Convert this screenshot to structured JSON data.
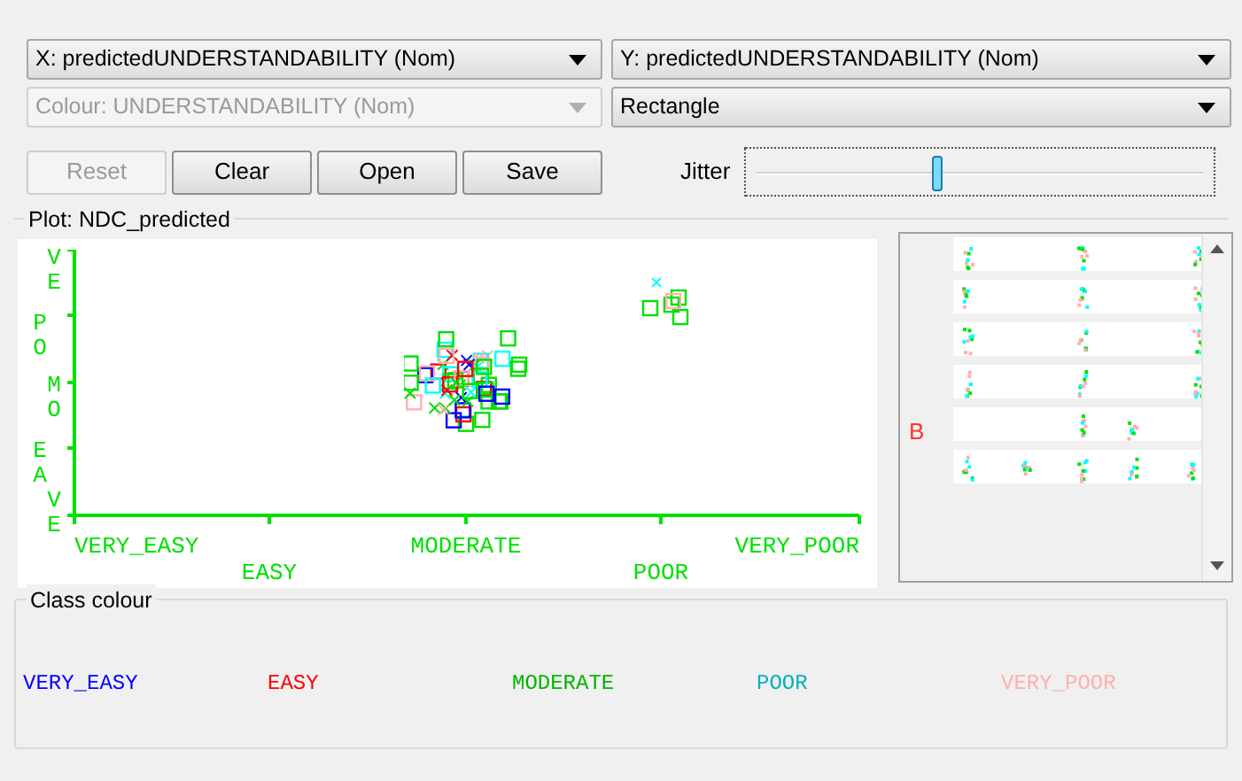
{
  "selectors": [
    {
      "label": "X: predictedUNDERSTANDABILITY (Nom)",
      "disabled": false
    },
    {
      "label": "Y: predictedUNDERSTANDABILITY (Nom)",
      "disabled": false
    },
    {
      "label": "Colour: UNDERSTANDABILITY (Nom)",
      "disabled": true
    },
    {
      "label": "Rectangle",
      "disabled": false
    }
  ],
  "buttons": [
    {
      "label": "Reset",
      "disabled": true
    },
    {
      "label": "Clear",
      "disabled": false
    },
    {
      "label": "Open",
      "disabled": false
    },
    {
      "label": "Save",
      "disabled": false
    }
  ],
  "jitter": {
    "label": "Jitter",
    "level": 0.41
  },
  "plot": {
    "title": "Plot: NDC_predicted",
    "y_labels": [
      "VE",
      "PO",
      "MO",
      "EA",
      "VE"
    ],
    "x_labels": [
      "VERY_EASY",
      "EASY",
      "MODERATE",
      "POOR",
      "VERY_POOR"
    ]
  },
  "attribute_panel": {
    "label": "B"
  },
  "class_colour": {
    "title": "Class colour",
    "items": [
      {
        "label": "VERY_EASY",
        "color": "#0000ff"
      },
      {
        "label": "EASY",
        "color": "#ff0000"
      },
      {
        "label": "MODERATE",
        "color": "#00b400"
      },
      {
        "label": "POOR",
        "color": "#00b0c0"
      },
      {
        "label": "VERY_POOR",
        "color": "#ffafaf"
      }
    ]
  }
}
